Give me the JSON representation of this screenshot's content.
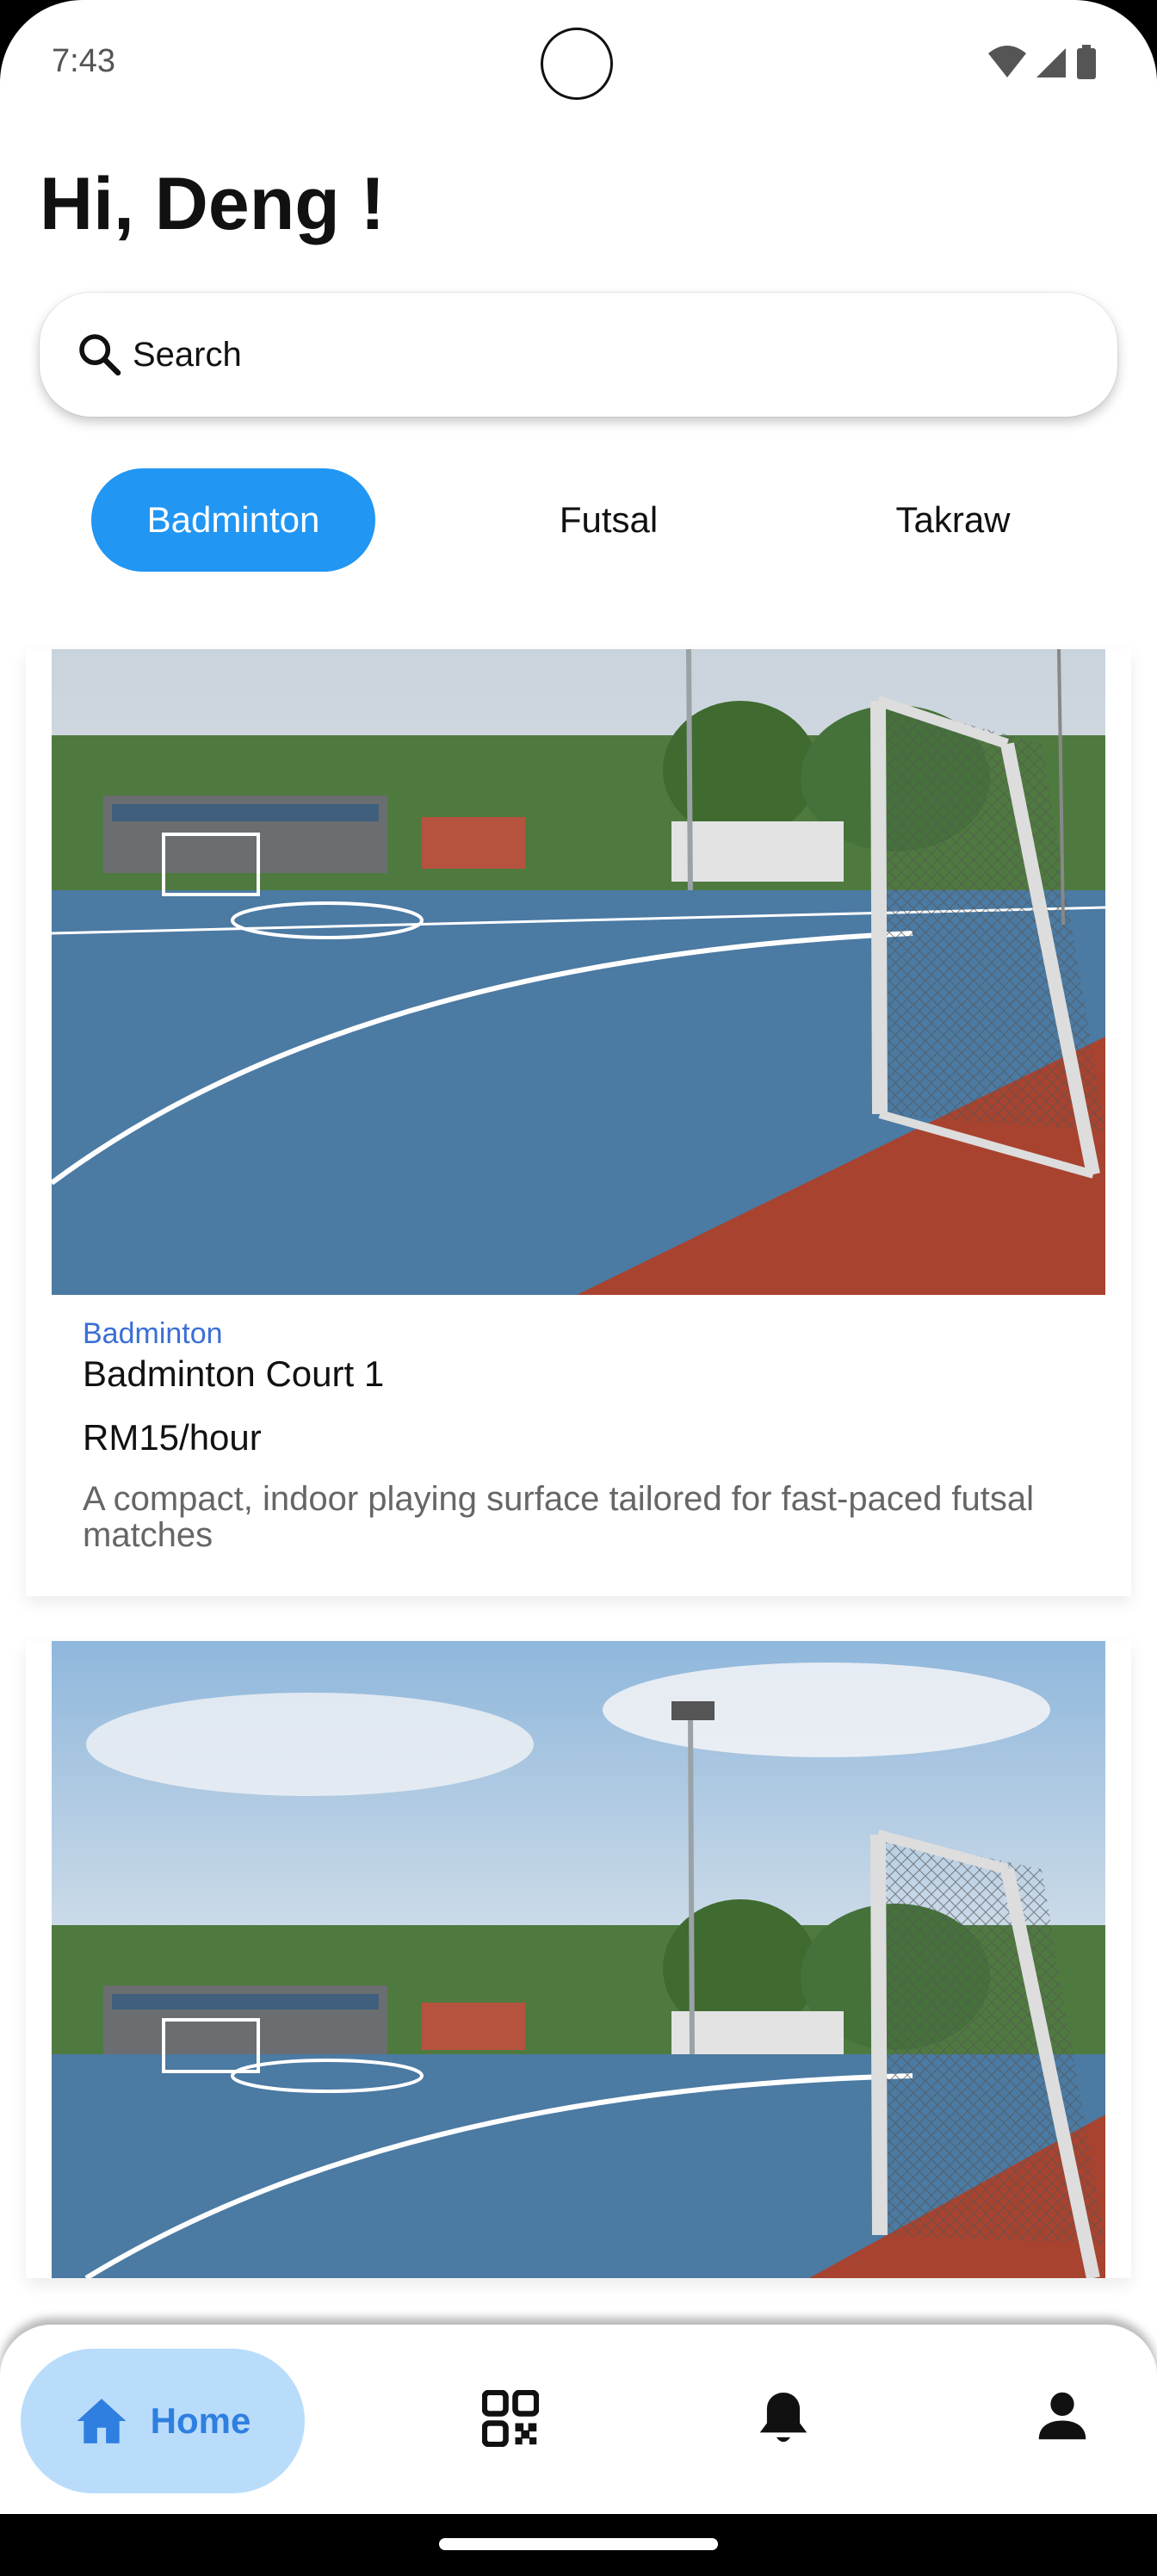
{
  "status_bar": {
    "time": "7:43"
  },
  "greeting": "Hi, Deng !",
  "search": {
    "placeholder": "Search"
  },
  "tabs": [
    {
      "label": "Badminton",
      "active": true
    },
    {
      "label": "Futsal",
      "active": false
    },
    {
      "label": "Takraw",
      "active": false
    }
  ],
  "cards": [
    {
      "category": "Badminton",
      "title": "Badminton Court 1",
      "price": "RM15/hour",
      "description": "A compact, indoor playing surface tailored for fast-paced futsal matches"
    },
    {
      "category": "",
      "title": "",
      "price": "",
      "description": ""
    }
  ],
  "bottom_nav": {
    "items": [
      {
        "label": "Home",
        "icon": "home-icon",
        "active": true
      },
      {
        "label": "",
        "icon": "qr-code-icon",
        "active": false
      },
      {
        "label": "",
        "icon": "bell-icon",
        "active": false
      },
      {
        "label": "",
        "icon": "person-icon",
        "active": false
      }
    ]
  },
  "colors": {
    "accent": "#2196f3",
    "nav_active_bg": "#b9dcfb",
    "nav_active_fg": "#2f7fe0",
    "category": "#3b6fd6"
  }
}
